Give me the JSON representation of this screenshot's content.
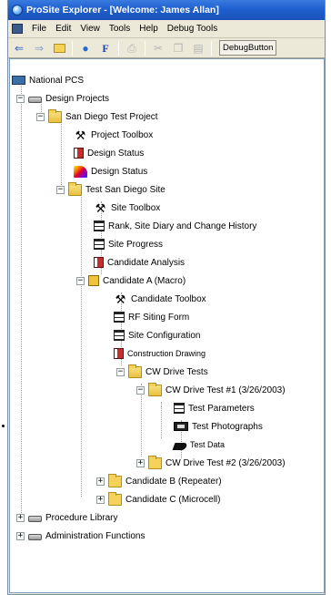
{
  "window": {
    "title": "ProSite Explorer - [Welcome: James Allan]"
  },
  "menu": {
    "file": "File",
    "edit": "Edit",
    "view": "View",
    "tools": "Tools",
    "help": "Help",
    "debug_tools": "Debug Tools"
  },
  "toolbar": {
    "debug_button": "DebugButton"
  },
  "tree": {
    "root": "National PCS",
    "design_projects": "Design Projects",
    "san_diego_test_project": "San Diego Test Project",
    "project_toolbox": "Project Toolbox",
    "design_status_1": "Design Status",
    "design_status_2": "Design Status",
    "test_san_diego_site": "Test San Diego Site",
    "site_toolbox": "Site Toolbox",
    "rank_site_diary": "Rank, Site Diary and Change History",
    "site_progress": "Site Progress",
    "candidate_analysis": "Candidate Analysis",
    "candidate_a": "Candidate A (Macro)",
    "candidate_toolbox": "Candidate Toolbox",
    "rf_siting_form": "RF Siting Form",
    "site_configuration": "Site Configuration",
    "construction_drawing": "Construction Drawing",
    "cw_drive_tests": "CW Drive Tests",
    "cw_drive_test_1": "CW Drive Test #1 (3/26/2003)",
    "test_parameters": "Test Parameters",
    "test_photographs": "Test Photographs",
    "test_data": "Test Data",
    "cw_drive_test_2": "CW Drive Test #2 (3/26/2003)",
    "candidate_b": "Candidate B (Repeater)",
    "candidate_c": "Candidate C (Microcell)",
    "procedure_library": "Procedure Library",
    "administration_functions": "Administration Functions"
  }
}
